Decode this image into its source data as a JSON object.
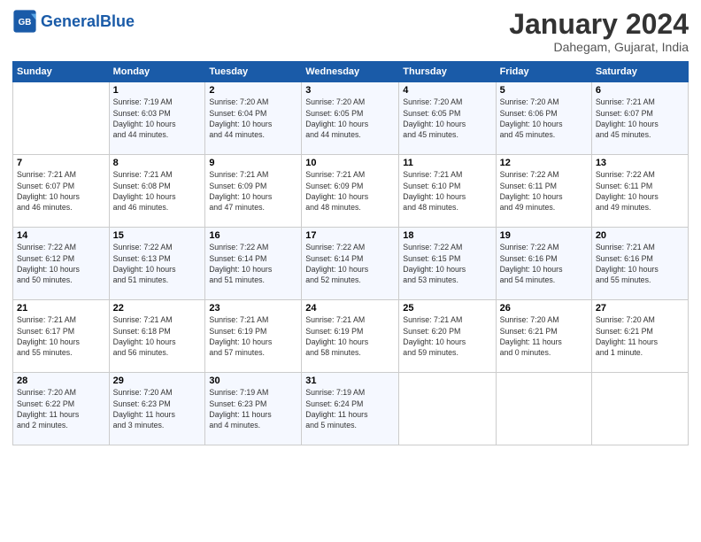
{
  "logo": {
    "text_general": "General",
    "text_blue": "Blue"
  },
  "title": "January 2024",
  "location": "Dahegam, Gujarat, India",
  "columns": [
    "Sunday",
    "Monday",
    "Tuesday",
    "Wednesday",
    "Thursday",
    "Friday",
    "Saturday"
  ],
  "weeks": [
    [
      {
        "day": "",
        "info": ""
      },
      {
        "day": "1",
        "info": "Sunrise: 7:19 AM\nSunset: 6:03 PM\nDaylight: 10 hours\nand 44 minutes."
      },
      {
        "day": "2",
        "info": "Sunrise: 7:20 AM\nSunset: 6:04 PM\nDaylight: 10 hours\nand 44 minutes."
      },
      {
        "day": "3",
        "info": "Sunrise: 7:20 AM\nSunset: 6:05 PM\nDaylight: 10 hours\nand 44 minutes."
      },
      {
        "day": "4",
        "info": "Sunrise: 7:20 AM\nSunset: 6:05 PM\nDaylight: 10 hours\nand 45 minutes."
      },
      {
        "day": "5",
        "info": "Sunrise: 7:20 AM\nSunset: 6:06 PM\nDaylight: 10 hours\nand 45 minutes."
      },
      {
        "day": "6",
        "info": "Sunrise: 7:21 AM\nSunset: 6:07 PM\nDaylight: 10 hours\nand 45 minutes."
      }
    ],
    [
      {
        "day": "7",
        "info": "Sunrise: 7:21 AM\nSunset: 6:07 PM\nDaylight: 10 hours\nand 46 minutes."
      },
      {
        "day": "8",
        "info": "Sunrise: 7:21 AM\nSunset: 6:08 PM\nDaylight: 10 hours\nand 46 minutes."
      },
      {
        "day": "9",
        "info": "Sunrise: 7:21 AM\nSunset: 6:09 PM\nDaylight: 10 hours\nand 47 minutes."
      },
      {
        "day": "10",
        "info": "Sunrise: 7:21 AM\nSunset: 6:09 PM\nDaylight: 10 hours\nand 48 minutes."
      },
      {
        "day": "11",
        "info": "Sunrise: 7:21 AM\nSunset: 6:10 PM\nDaylight: 10 hours\nand 48 minutes."
      },
      {
        "day": "12",
        "info": "Sunrise: 7:22 AM\nSunset: 6:11 PM\nDaylight: 10 hours\nand 49 minutes."
      },
      {
        "day": "13",
        "info": "Sunrise: 7:22 AM\nSunset: 6:11 PM\nDaylight: 10 hours\nand 49 minutes."
      }
    ],
    [
      {
        "day": "14",
        "info": "Sunrise: 7:22 AM\nSunset: 6:12 PM\nDaylight: 10 hours\nand 50 minutes."
      },
      {
        "day": "15",
        "info": "Sunrise: 7:22 AM\nSunset: 6:13 PM\nDaylight: 10 hours\nand 51 minutes."
      },
      {
        "day": "16",
        "info": "Sunrise: 7:22 AM\nSunset: 6:14 PM\nDaylight: 10 hours\nand 51 minutes."
      },
      {
        "day": "17",
        "info": "Sunrise: 7:22 AM\nSunset: 6:14 PM\nDaylight: 10 hours\nand 52 minutes."
      },
      {
        "day": "18",
        "info": "Sunrise: 7:22 AM\nSunset: 6:15 PM\nDaylight: 10 hours\nand 53 minutes."
      },
      {
        "day": "19",
        "info": "Sunrise: 7:22 AM\nSunset: 6:16 PM\nDaylight: 10 hours\nand 54 minutes."
      },
      {
        "day": "20",
        "info": "Sunrise: 7:21 AM\nSunset: 6:16 PM\nDaylight: 10 hours\nand 55 minutes."
      }
    ],
    [
      {
        "day": "21",
        "info": "Sunrise: 7:21 AM\nSunset: 6:17 PM\nDaylight: 10 hours\nand 55 minutes."
      },
      {
        "day": "22",
        "info": "Sunrise: 7:21 AM\nSunset: 6:18 PM\nDaylight: 10 hours\nand 56 minutes."
      },
      {
        "day": "23",
        "info": "Sunrise: 7:21 AM\nSunset: 6:19 PM\nDaylight: 10 hours\nand 57 minutes."
      },
      {
        "day": "24",
        "info": "Sunrise: 7:21 AM\nSunset: 6:19 PM\nDaylight: 10 hours\nand 58 minutes."
      },
      {
        "day": "25",
        "info": "Sunrise: 7:21 AM\nSunset: 6:20 PM\nDaylight: 10 hours\nand 59 minutes."
      },
      {
        "day": "26",
        "info": "Sunrise: 7:20 AM\nSunset: 6:21 PM\nDaylight: 11 hours\nand 0 minutes."
      },
      {
        "day": "27",
        "info": "Sunrise: 7:20 AM\nSunset: 6:21 PM\nDaylight: 11 hours\nand 1 minute."
      }
    ],
    [
      {
        "day": "28",
        "info": "Sunrise: 7:20 AM\nSunset: 6:22 PM\nDaylight: 11 hours\nand 2 minutes."
      },
      {
        "day": "29",
        "info": "Sunrise: 7:20 AM\nSunset: 6:23 PM\nDaylight: 11 hours\nand 3 minutes."
      },
      {
        "day": "30",
        "info": "Sunrise: 7:19 AM\nSunset: 6:23 PM\nDaylight: 11 hours\nand 4 minutes."
      },
      {
        "day": "31",
        "info": "Sunrise: 7:19 AM\nSunset: 6:24 PM\nDaylight: 11 hours\nand 5 minutes."
      },
      {
        "day": "",
        "info": ""
      },
      {
        "day": "",
        "info": ""
      },
      {
        "day": "",
        "info": ""
      }
    ]
  ]
}
